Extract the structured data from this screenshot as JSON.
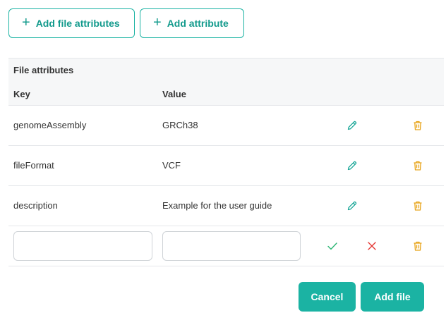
{
  "toolbar": {
    "add_file_attributes_label": "Add file attributes",
    "add_attribute_label": "Add attribute"
  },
  "table": {
    "title": "File attributes",
    "columns": {
      "key": "Key",
      "value": "Value"
    },
    "rows": [
      {
        "key": "genomeAssembly",
        "value": "GRCh38"
      },
      {
        "key": "fileFormat",
        "value": "VCF"
      },
      {
        "key": "description",
        "value": "Example for the user guide"
      }
    ],
    "new_row": {
      "key_value": "",
      "value_value": ""
    }
  },
  "footer": {
    "cancel_label": "Cancel",
    "add_file_label": "Add file"
  },
  "colors": {
    "accent": "#1bb3a3",
    "edit_icon": "#17a697",
    "delete_icon": "#e8a317",
    "confirm_icon": "#2ab573",
    "cancel_icon": "#e53935"
  },
  "icons": {
    "plus": "plus-icon",
    "edit": "pencil-icon",
    "delete": "trash-icon",
    "confirm": "check-icon",
    "cancel": "close-icon"
  }
}
